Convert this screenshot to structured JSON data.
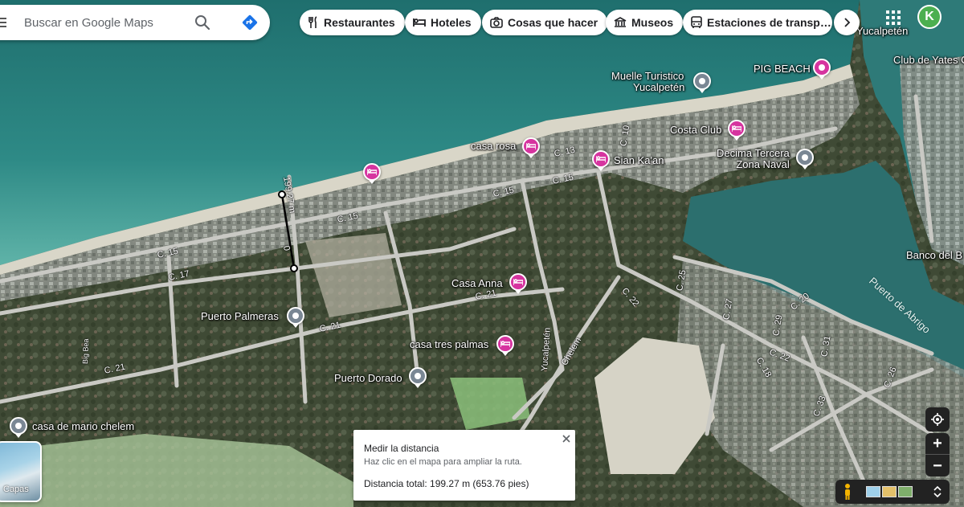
{
  "search": {
    "placeholder": "Buscar en Google Maps"
  },
  "chips": [
    {
      "label": "Restaurantes",
      "icon": "fork-knife-icon"
    },
    {
      "label": "Hoteles",
      "icon": "bed-icon"
    },
    {
      "label": "Cosas que hacer",
      "icon": "camera-icon"
    },
    {
      "label": "Museos",
      "icon": "museum-icon"
    },
    {
      "label": "Estaciones de transp…",
      "icon": "bus-icon"
    }
  ],
  "account": {
    "initial": "K",
    "color": "#4caf50"
  },
  "map": {
    "places": [
      {
        "name": "Muelle Turístico Yucalpetén",
        "line1": "Muelle Turistico",
        "line2": "Yucalpetén",
        "kind": "place"
      },
      {
        "name": "PIG BEACH",
        "kind": "museum"
      },
      {
        "name": "Costa Club",
        "kind": "hotel"
      },
      {
        "name": "casa rosa",
        "kind": "hotel"
      },
      {
        "name": "Sian Ka'an",
        "kind": "hotel"
      },
      {
        "name": "Decima Tercera Zona Naval",
        "line1": "Decima Tercera",
        "line2": "Zona Naval",
        "kind": "place"
      },
      {
        "name": "Casa Anna",
        "kind": "hotel"
      },
      {
        "name": "Puerto Palmeras",
        "kind": "place"
      },
      {
        "name": "casa tres palmas",
        "kind": "hotel"
      },
      {
        "name": "Puerto Dorado",
        "kind": "place"
      },
      {
        "name": "casa de mario chelem",
        "kind": "place"
      },
      {
        "name": "Club de Yates C",
        "kind": "label"
      },
      {
        "name": "Banco del B",
        "kind": "label"
      },
      {
        "name": "Yucalpetén",
        "kind": "label"
      }
    ],
    "roads": [
      "C. 15",
      "C. 15",
      "C. 15",
      "C. 15",
      "C. 13",
      "C. 17",
      "C. 21",
      "C. 21",
      "C. 21",
      "C. 22",
      "C. 22",
      "C. 25",
      "C. 27",
      "C. 29",
      "C. 31",
      "C. 18",
      "C. 20",
      "C. 33",
      "C. 26",
      "C. 10",
      "Yucalpetén",
      "Chelem",
      "Big Bea"
    ],
    "water": [
      "Puerto de Abrigo"
    ],
    "measure_line_label": "199.27 m",
    "measure_line_tick": "0"
  },
  "layers": {
    "label": "Capas"
  },
  "measure": {
    "title": "Medir la distancia",
    "hint": "Haz clic en el mapa para ampliar la ruta.",
    "total": "Distancia total: 199.27 m (653.76 pies)"
  },
  "colors": {
    "hotel_pin": "#d6349f",
    "place_pin": "#7a8794",
    "sea": "#2f8a86",
    "land": "#4a5a3e"
  }
}
